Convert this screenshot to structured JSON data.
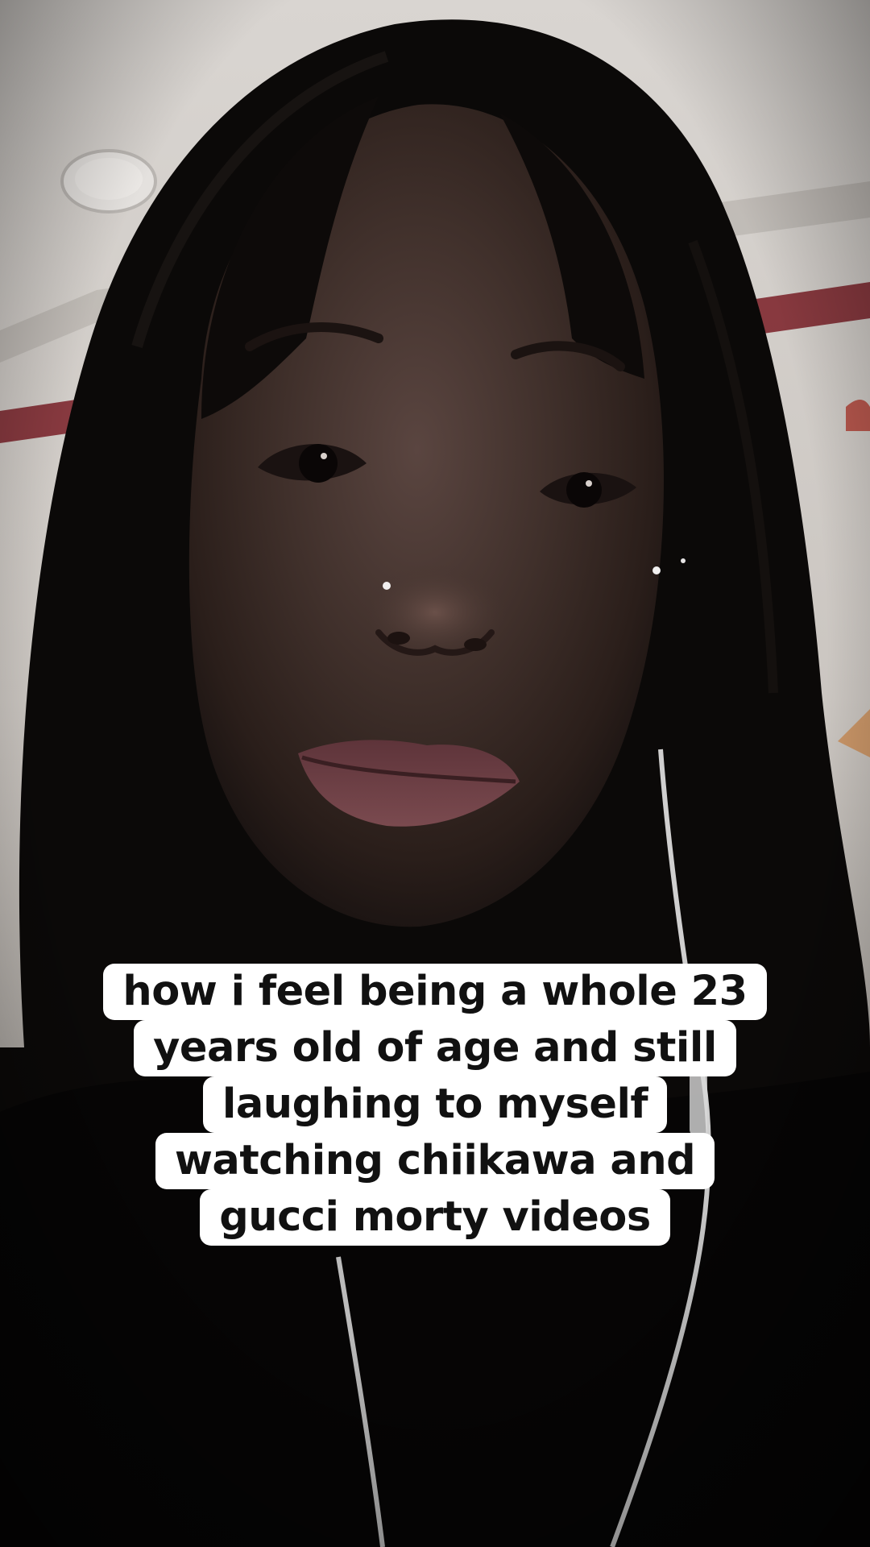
{
  "caption": {
    "lines": [
      "how i feel being a whole 23",
      "years old of age and still",
      "laughing to myself",
      "watching chiikawa and",
      "gucci morty videos"
    ]
  },
  "colors": {
    "caption_background": "#ffffff",
    "caption_text": "#111111",
    "wall": "#cfcac6",
    "hair": "#0a0807",
    "skin_shadow": "#3a2a26",
    "lips": "#6e3f44",
    "wall_stripe": "#7a1f27",
    "earphone_cable": "#e6e6e6"
  },
  "icons": {
    "ceiling_light": "ceiling-light-icon",
    "wall_decoration": "strawberry-decoration-icon"
  }
}
